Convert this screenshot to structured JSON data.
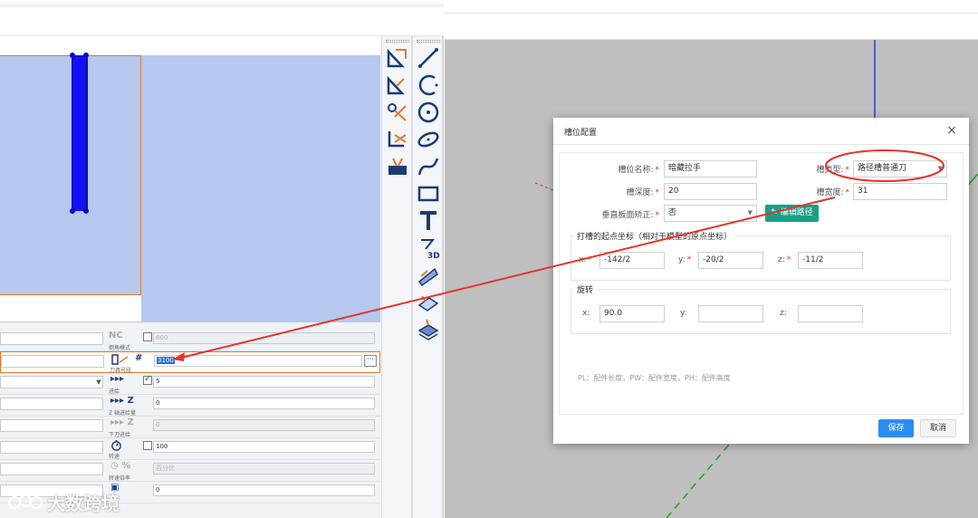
{
  "left_panel": {
    "props": {
      "row1": {
        "caption": "倒角模式",
        "value": "600",
        "badge": "NC"
      },
      "row2": {
        "caption": "刀具号段",
        "value": "3100",
        "hash": "#"
      },
      "row3": {
        "caption": "进给",
        "value": "5"
      },
      "row4": {
        "caption": "Z 轴进给量",
        "value": "0",
        "axis": "Z"
      },
      "row5": {
        "caption": "下刀进给",
        "value": "0",
        "axis": "Z"
      },
      "row6": {
        "caption": "转速",
        "value": "100"
      },
      "row7": {
        "caption": "转速倍率",
        "value": "百分比",
        "pct": "%"
      },
      "row8": {
        "value": "0"
      }
    }
  },
  "dialog": {
    "title": "槽位配置",
    "close": "×",
    "fields": {
      "name": {
        "label": "槽位名称:",
        "value": "暗藏拉手"
      },
      "slot_type": {
        "label": "槽类型:",
        "value": "路径槽普通刀"
      },
      "depth": {
        "label": "槽深度:",
        "value": "20"
      },
      "width": {
        "label": "槽宽度:",
        "value": "31"
      },
      "vertical": {
        "label": "垂直板面矫正:",
        "value": "否"
      }
    },
    "edit_path_label": "编辑路径",
    "origin_section": {
      "legend": "打槽的起点坐标（相对于模型的原点坐标）",
      "x_label": "x:",
      "x_value": "-142/2",
      "y_label": "y:",
      "y_value": "-20/2",
      "z_label": "z:",
      "z_value": "-11/2"
    },
    "rotation_section": {
      "legend": "旋转",
      "x_label": "x:",
      "x_value": "90.0",
      "y_label": "y:",
      "y_value": "",
      "z_label": "z:",
      "z_value": ""
    },
    "hint": "PL：配件长度，PW：配件宽度，PH：配件高度",
    "save_label": "保存",
    "cancel_label": "取消"
  },
  "watermark": {
    "text": "大数跨境"
  },
  "colors": {
    "accent": "#2d8cf0",
    "edit_button": "#17a085",
    "annotation": "#e8312a",
    "groove": "#1411f4",
    "panel": "#b6c8ee"
  }
}
